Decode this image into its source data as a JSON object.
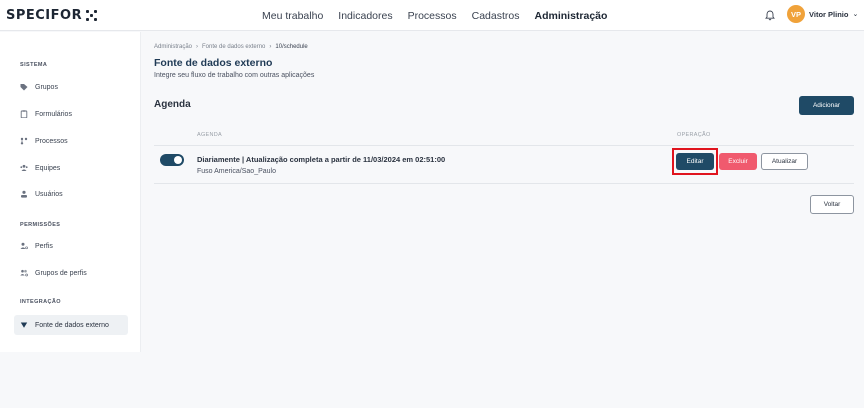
{
  "header": {
    "logo": "SPECIFOR",
    "nav": [
      "Meu trabalho",
      "Indicadores",
      "Processos",
      "Cadastros",
      "Administração"
    ],
    "active_nav": "Administração",
    "user": {
      "initials": "VP",
      "name": "Vitor Plinio"
    },
    "colors": {
      "avatar": "#f0a23a"
    }
  },
  "sidebar": {
    "sections": [
      {
        "title": "SISTEMA",
        "items": [
          {
            "label": "Grupos",
            "icon": "tag-icon"
          },
          {
            "label": "Formulários",
            "icon": "clipboard-icon"
          },
          {
            "label": "Processos",
            "icon": "process-icon"
          },
          {
            "label": "Equipes",
            "icon": "team-icon"
          },
          {
            "label": "Usuários",
            "icon": "user-icon"
          }
        ]
      },
      {
        "title": "PERMISSÕES",
        "items": [
          {
            "label": "Perfis",
            "icon": "profile-icon"
          },
          {
            "label": "Grupos de perfis",
            "icon": "profile-group-icon"
          }
        ]
      },
      {
        "title": "INTEGRAÇÃO",
        "items": [
          {
            "label": "Fonte de dados externo",
            "icon": "funnel-icon",
            "active": true
          }
        ]
      }
    ]
  },
  "main": {
    "breadcrumb": [
      "Administração",
      "Fonte de dados externo",
      "10/schedule"
    ],
    "title": "Fonte de dados externo",
    "subtitle": "Integre seu fluxo de trabalho com outras aplicações",
    "section_title": "Agenda",
    "add_label": "Adicionar",
    "columns": [
      "AGENDA",
      "OPERAÇÃO"
    ],
    "rows": [
      {
        "enabled": true,
        "title": "Diariamente | Atualização completa a partir de 11/03/2024 em 02:51:00",
        "timezone": "Fuso America/Sao_Paulo",
        "actions": {
          "edit": "Editar",
          "delete": "Excluir",
          "update": "Atualizar"
        }
      }
    ],
    "back_label": "Voltar",
    "colors": {
      "primary": "#1f4a66",
      "danger": "#f05a6e",
      "highlight": "#e0141e"
    }
  }
}
